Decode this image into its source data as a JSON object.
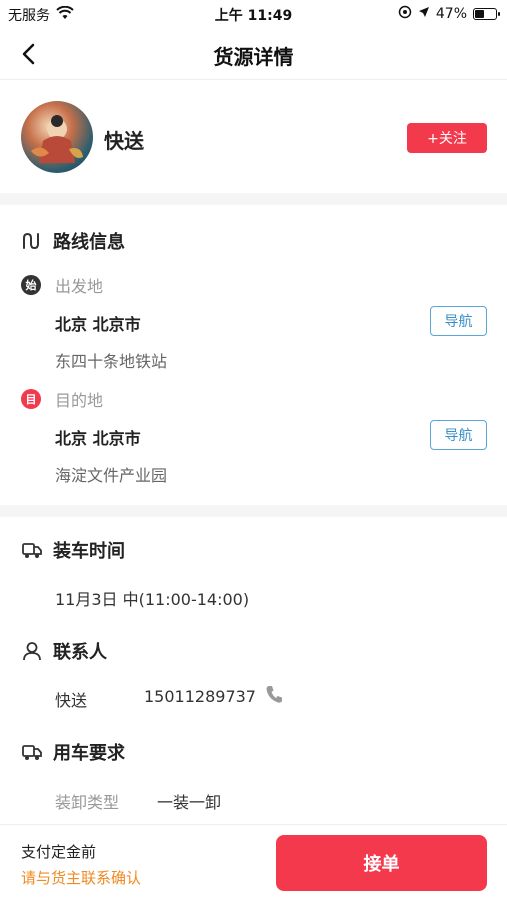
{
  "status_bar": {
    "carrier": "无服务",
    "time": "上午 11:49",
    "battery": "47%",
    "battery_level": 0.47
  },
  "nav": {
    "title": "货源详情"
  },
  "profile": {
    "name": "快送",
    "follow_label": "+关注"
  },
  "route": {
    "title": "路线信息",
    "origin": {
      "badge": "始",
      "label": "出发地",
      "city": "北京 北京市",
      "address": "东四十条地铁站",
      "nav_label": "导航"
    },
    "destination": {
      "badge": "目",
      "label": "目的地",
      "city": "北京 北京市",
      "address": "海淀文件产业园",
      "nav_label": "导航"
    }
  },
  "loading": {
    "title": "装车时间",
    "value": "11月3日 中(11:00-14:00)"
  },
  "contact": {
    "title": "联系人",
    "name": "快送",
    "phone": "15011289737"
  },
  "vehicle": {
    "title": "用车要求",
    "field_label": "装卸类型",
    "field_value": "一装一卸"
  },
  "bottom": {
    "pay_note": "支付定金前",
    "confirm_note": "请与货主联系确认",
    "accept_label": "接单"
  },
  "colors": {
    "accent": "#f4394d",
    "nav_blue": "#3a8fc8",
    "warning": "#f08a24"
  },
  "icons": [
    "wifi-icon",
    "location-icon",
    "arrow-icon",
    "back-icon",
    "route-icon",
    "truck-icon",
    "person-icon",
    "phone-icon"
  ]
}
